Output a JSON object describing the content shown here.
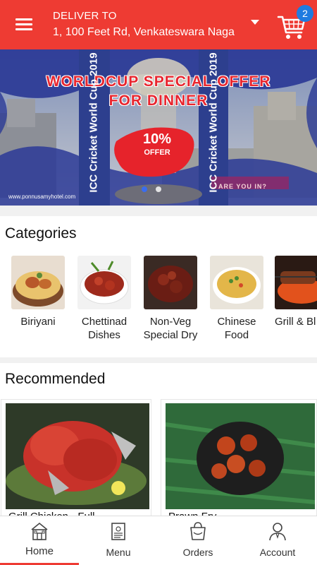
{
  "header": {
    "deliver_label": "DELIVER TO",
    "address": "1, 100 Feet Rd, Venkateswara Naga",
    "cart_count": "2"
  },
  "banner": {
    "title_line1": "WORLDCUP SPECIAL OFFER",
    "title_line2": "FOR DINNER",
    "offer_percent": "10%",
    "offer_label": "OFFER",
    "website": "www.ponnusamyhotel.com",
    "side_text": "ICC Cricket World Cup 2019",
    "slogan": "ARE YOU IN?"
  },
  "categories": {
    "title": "Categories",
    "items": [
      {
        "label": "Biriyani"
      },
      {
        "label": "Chettinad\nDishes"
      },
      {
        "label": "Non-Veg\nSpecial Dry"
      },
      {
        "label": "Chinese\nFood"
      },
      {
        "label": "Grill & Bl"
      }
    ]
  },
  "recommended": {
    "title": "Recommended",
    "items": [
      {
        "name": "Grill Chicken - Full"
      },
      {
        "name": "Prawn Fry"
      }
    ]
  },
  "nav": {
    "items": [
      {
        "label": "Home"
      },
      {
        "label": "Menu"
      },
      {
        "label": "Orders"
      },
      {
        "label": "Account"
      }
    ],
    "active": "Home"
  },
  "colors": {
    "primary": "#ee3b33",
    "badge": "#1f7be0",
    "banner_blue": "#2c3a8f"
  }
}
